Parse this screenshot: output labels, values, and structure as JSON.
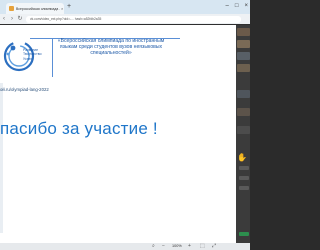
{
  "browser": {
    "tab_title": "Всероссийская олимпиада ...",
    "tab_close": "×",
    "new_tab": "+",
    "window_controls": [
      "–",
      "□",
      "×"
    ],
    "nav_icons": [
      "back-icon",
      "forward-icon",
      "reload-icon"
    ],
    "url": "vk.com/video_ext.php?oid=-... hash=a52fdb2a35"
  },
  "slide": {
    "olympiad_title": "«Всероссийская олимпиада по иностранным языкам среди студентов вузов неязыковых специальностей»",
    "logo_text": "Развитие Творчество Успех",
    "link_text": "ой.ru/olympiad-lang-2022",
    "thanks_text": "пасибо за участие !",
    "accent_color": "#1f76c9"
  },
  "side_panel": {
    "reaction_icon": "hand-raise-icon"
  },
  "bottombar": {
    "zoom_label": "100%",
    "icons": [
      "search-icon",
      "zoom-out-icon",
      "zoom-in-icon",
      "fit-icon",
      "fullscreen-icon"
    ]
  }
}
